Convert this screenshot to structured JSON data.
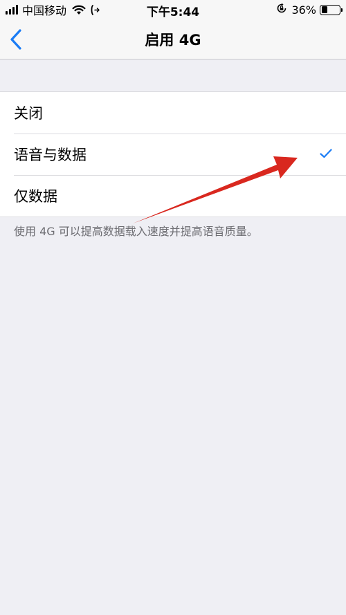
{
  "status_bar": {
    "carrier": "中国移动",
    "time": "下午5:44",
    "battery_percent": "36%",
    "battery_level": 0.36,
    "icons": [
      "signal-icon",
      "wifi-icon",
      "call-forward-icon",
      "rotation-lock-icon",
      "battery-icon"
    ]
  },
  "nav": {
    "title": "启用 4G",
    "back_icon": "chevron-left-icon"
  },
  "options": [
    {
      "label": "关闭",
      "selected": false
    },
    {
      "label": "语音与数据",
      "selected": true
    },
    {
      "label": "仅数据",
      "selected": false
    }
  ],
  "footer_note": "使用 4G 可以提高数据载入速度并提高语音质量。",
  "colors": {
    "accent": "#1a7cf5",
    "annotation_arrow": "#d9281f",
    "background": "#efeff4"
  }
}
